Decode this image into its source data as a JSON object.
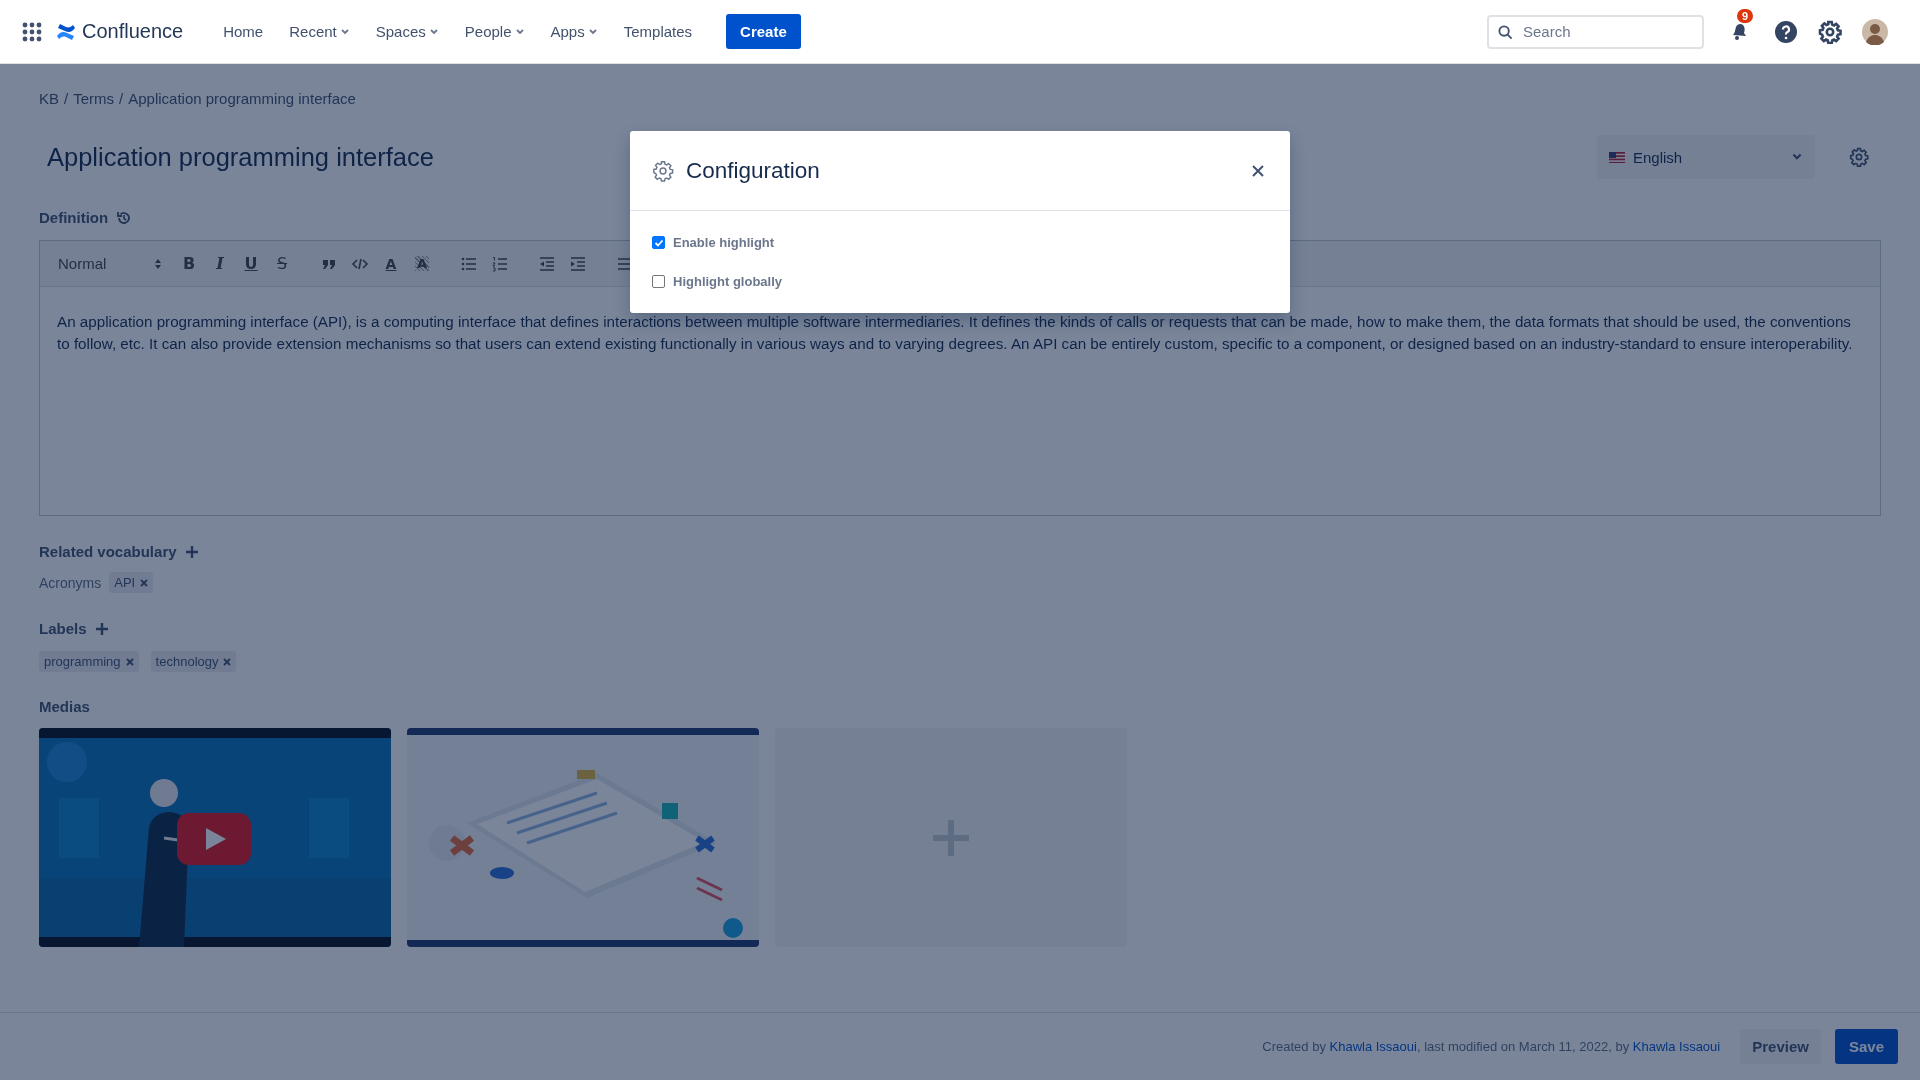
{
  "nav": {
    "product": "Confluence",
    "items": [
      {
        "label": "Home",
        "dropdown": false
      },
      {
        "label": "Recent",
        "dropdown": true
      },
      {
        "label": "Spaces",
        "dropdown": true
      },
      {
        "label": "People",
        "dropdown": true
      },
      {
        "label": "Apps",
        "dropdown": true
      },
      {
        "label": "Templates",
        "dropdown": false
      }
    ],
    "create_button": "Create",
    "search": {
      "placeholder": "Search"
    },
    "notification_count": "9"
  },
  "breadcrumb": {
    "separator": "/",
    "items": [
      "KB",
      "Terms",
      "Application programming interface"
    ]
  },
  "title": "Application programming interface",
  "language": {
    "value": "English"
  },
  "definition": {
    "label": "Definition",
    "style": "Normal",
    "toolbar": [
      {
        "kind": "bold",
        "glyph": "B"
      },
      {
        "kind": "italic",
        "glyph": "I"
      },
      {
        "kind": "underline",
        "glyph": "U"
      },
      {
        "kind": "strike",
        "glyph": "S"
      },
      {
        "kind": "quote"
      },
      {
        "kind": "code"
      },
      {
        "kind": "color",
        "glyph": "A"
      },
      {
        "kind": "background",
        "glyph": "A"
      },
      {
        "kind": "bullet"
      },
      {
        "kind": "ordered"
      },
      {
        "kind": "outdent"
      },
      {
        "kind": "indent"
      },
      {
        "kind": "align"
      }
    ],
    "text": "An application programming interface (API), is a computing interface that defines interactions between multiple software intermediaries. It defines the kinds of calls or requests that can be made, how to make them, the data formats that should be used, the conventions to follow, etc. It can also provide extension mechanisms so that users can extend existing functionally in various ways and to varying degrees. An API can be entirely custom, specific to a component, or designed based on an industry-standard to ensure interoperability."
  },
  "related_vocabulary": {
    "label": "Related vocabulary",
    "groups": [
      {
        "label": "Acronyms",
        "tags": [
          "API"
        ]
      }
    ]
  },
  "labels": {
    "label": "Labels",
    "tags": [
      "programming",
      "technology"
    ]
  },
  "medias": {
    "label": "Medias",
    "items": [
      {
        "kind": "video"
      },
      {
        "kind": "picture"
      },
      {
        "kind": "add"
      }
    ]
  },
  "footer": {
    "meta": [
      {
        "text": "Created by ",
        "link": false
      },
      {
        "text": "Khawla Issaoui",
        "link": true
      },
      {
        "text": ", last modified on March 11, 2022, by ",
        "link": false
      },
      {
        "text": "Khawla Issaoui",
        "link": true
      }
    ],
    "preview_button": "Preview",
    "save_button": "Save"
  },
  "modal": {
    "title": "Configuration",
    "options": [
      {
        "label": "Enable highlight",
        "checked": true
      },
      {
        "label": "Highlight globally",
        "checked": false
      }
    ]
  }
}
